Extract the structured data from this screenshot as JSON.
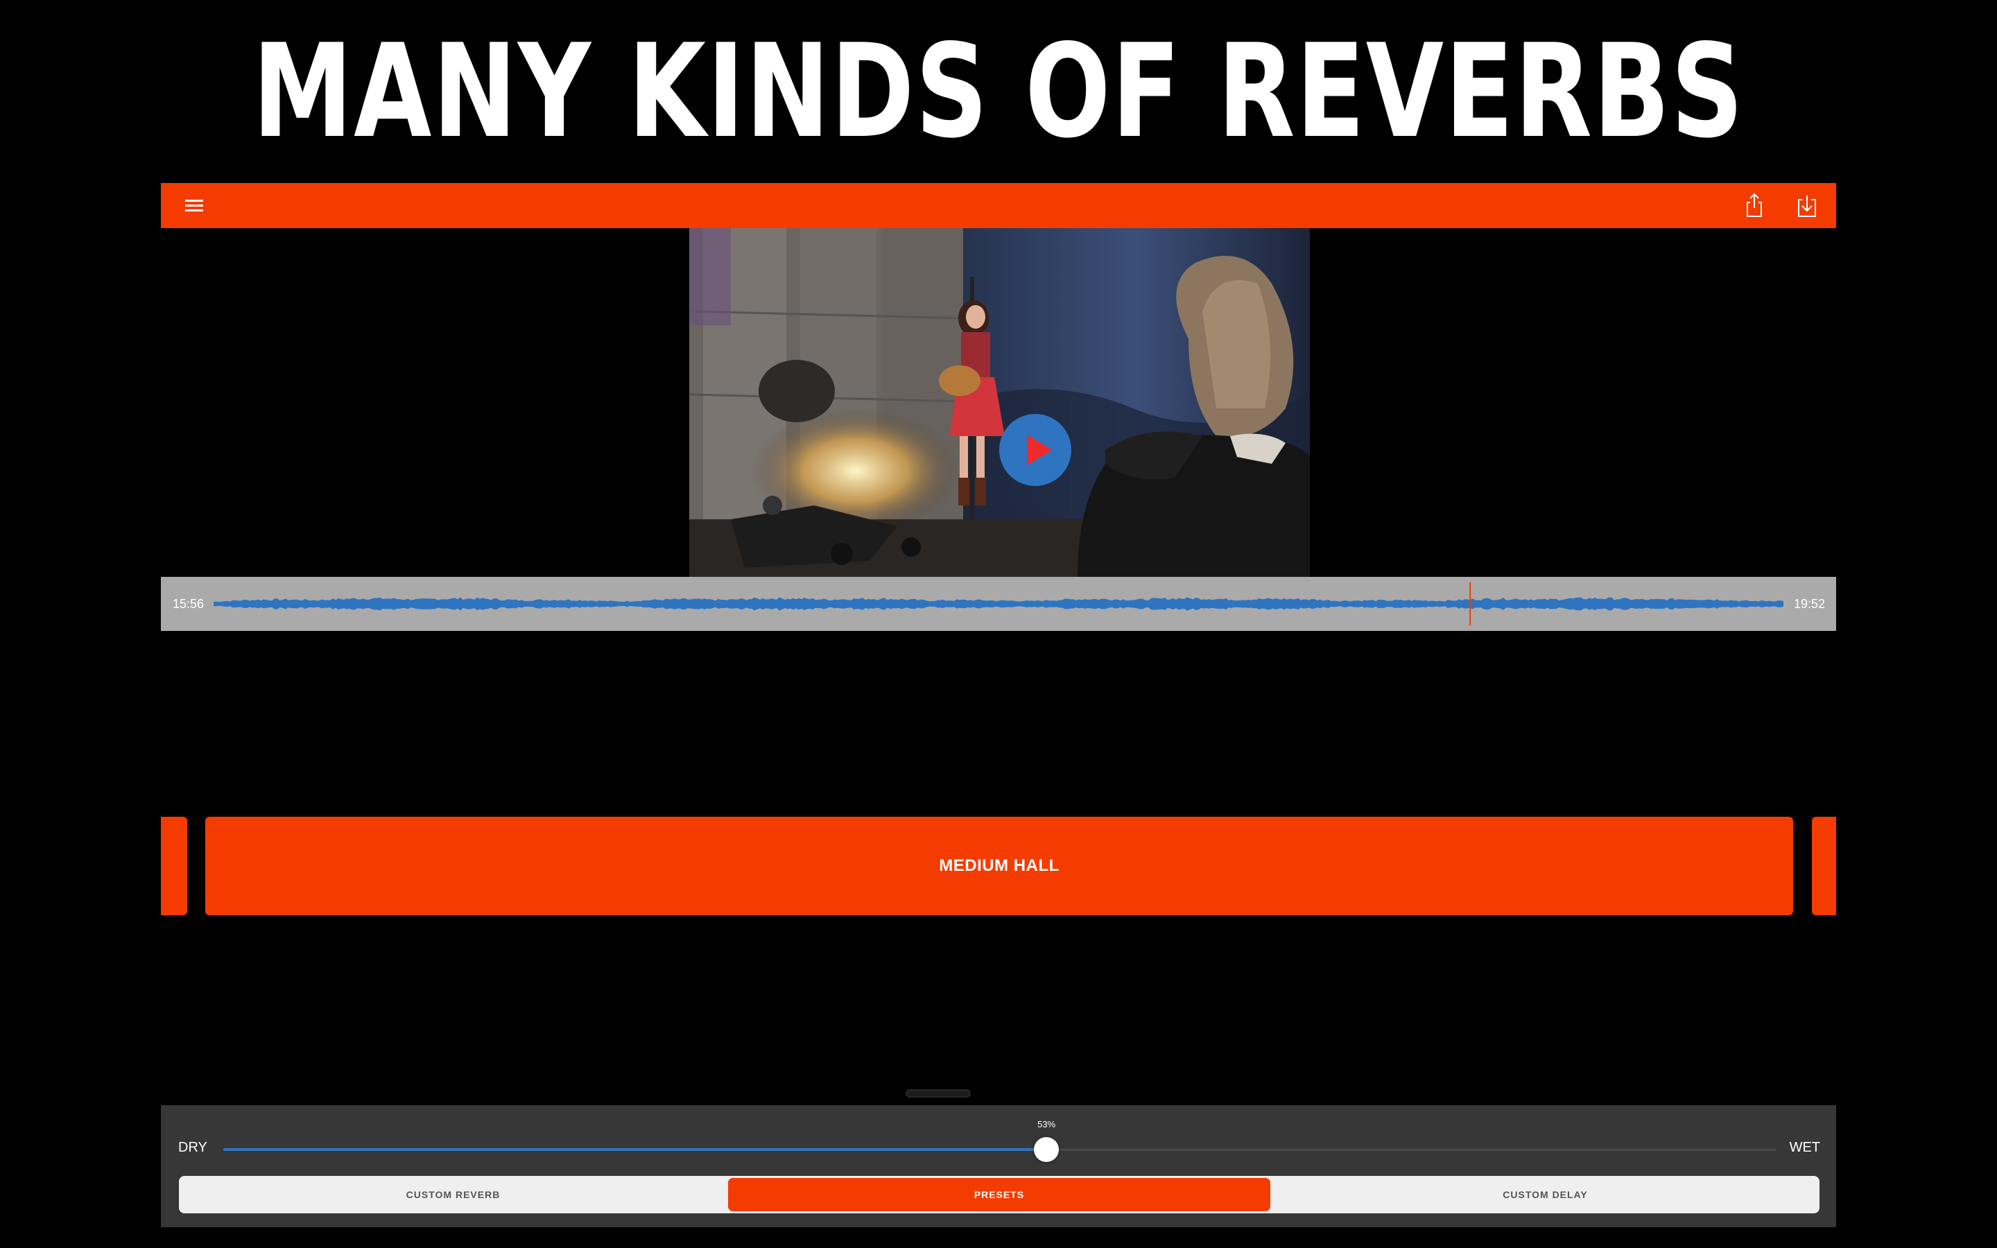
{
  "headline": "MANY KINDS OF REVERBS",
  "colors": {
    "accent": "#f43c00",
    "blue": "#2f74c0",
    "panel": "#373737",
    "waveform_bg": "#aaaaaa"
  },
  "toolbar": {
    "menu_icon": "hamburger-menu-icon",
    "share_icon": "share-icon",
    "save_icon": "download-icon"
  },
  "player": {
    "play_icon": "play-icon"
  },
  "waveform": {
    "start_time": "15:56",
    "end_time": "19:52",
    "playhead_fraction": 0.8
  },
  "presets": {
    "current": "MEDIUM HALL"
  },
  "mix": {
    "dry_label": "DRY",
    "wet_label": "WET",
    "value_label": "53%",
    "value": 53
  },
  "tabs": {
    "custom_reverb": "CUSTOM REVERB",
    "presets": "PRESETS",
    "custom_delay": "CUSTOM DELAY",
    "selected": "presets"
  }
}
